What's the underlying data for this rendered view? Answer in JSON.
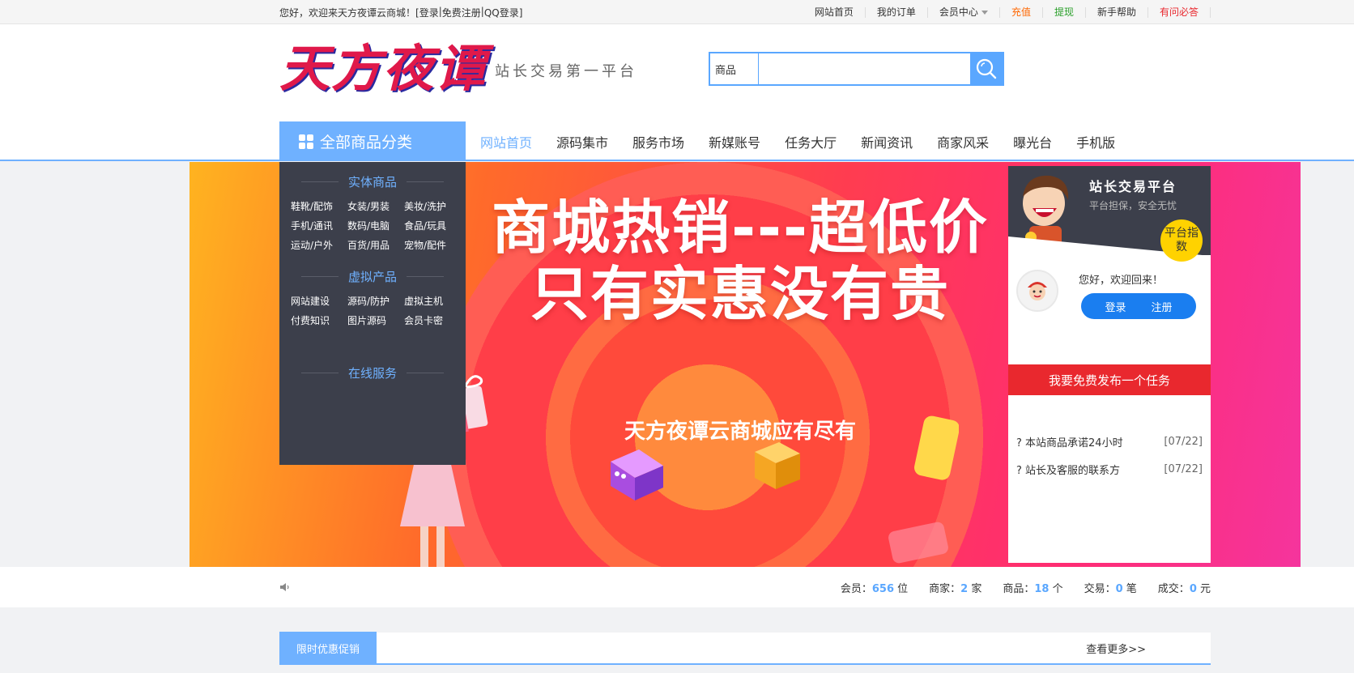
{
  "topbar": {
    "welcome_text": "您好，欢迎来天方夜谭云商城！",
    "login": "[登录",
    "sep1": " | ",
    "register": "免费注册",
    "sep2": " | ",
    "qq_login": "QQ登录]",
    "links": [
      {
        "label": "网站首页",
        "color": "#333333"
      },
      {
        "label": "我的订单",
        "color": "#333333"
      },
      {
        "label": "会员中心",
        "color": "#333333"
      },
      {
        "label": "充值",
        "color": "#ff6600"
      },
      {
        "label": "提现",
        "color": "#2ba02b"
      },
      {
        "label": "新手帮助",
        "color": "#333333"
      },
      {
        "label": "有问必答",
        "color": "#e9282e"
      }
    ]
  },
  "header": {
    "logo_text": "天方夜谭",
    "slogan": "站长交易第一平台",
    "search_category": "商品",
    "search_placeholder": ""
  },
  "nav": {
    "all_categories": "全部商品分类",
    "items": [
      "网站首页",
      "源码集市",
      "服务市场",
      "新媒账号",
      "任务大厅",
      "新闻资讯",
      "商家风采",
      "曝光台",
      "手机版"
    ],
    "active_index": 0
  },
  "category_menu": {
    "sections": [
      {
        "title": "实体商品",
        "links": [
          "鞋靴/配饰",
          "女装/男装",
          "美妆/洗护",
          "手机/通讯",
          "数码/电脑",
          "食品/玩具",
          "运动/户外",
          "百货/用品",
          "宠物/配件"
        ]
      },
      {
        "title": "虚拟产品",
        "links": [
          "网站建设",
          "源码/防护",
          "虚拟主机",
          "付费知识",
          "图片源码",
          "会员卡密"
        ]
      },
      {
        "title": "在线服务",
        "links": []
      }
    ]
  },
  "banner": {
    "headline_1": "商城热销---超低价",
    "headline_2": "只有实惠没有贵",
    "tagline": "天方夜谭云商城应有尽有"
  },
  "right_panel": {
    "title": "站长交易平台",
    "subtitle": "平台担保，安全无忧",
    "badge": "平台指数",
    "greeting": "您好，欢迎回来！",
    "login_btn": "登录",
    "register_btn": "注册",
    "task_btn": "我要免费发布一个任务",
    "news": [
      {
        "title": "? 本站商品承诺24小时",
        "date": "[07/22]"
      },
      {
        "title": "? 站长及客服的联系方",
        "date": "[07/22]"
      }
    ]
  },
  "stats": {
    "members_label": "会员：",
    "members_value": "656",
    "members_unit": " 位",
    "merchants_label": "商家：",
    "merchants_value": "2",
    "merchants_unit": " 家",
    "goods_label": "商品：",
    "goods_value": "18",
    "goods_unit": " 个",
    "trades_label": "交易：",
    "trades_value": "0",
    "trades_unit": " 笔",
    "volume_label": "成交：",
    "volume_value": "0",
    "volume_unit": " 元"
  },
  "promo": {
    "tab": "限时优惠促销",
    "more": "查看更多>>"
  },
  "colors": {
    "accent": "#6fb1ff",
    "dark_panel": "#3c3f4b",
    "red": "#e9282e"
  }
}
